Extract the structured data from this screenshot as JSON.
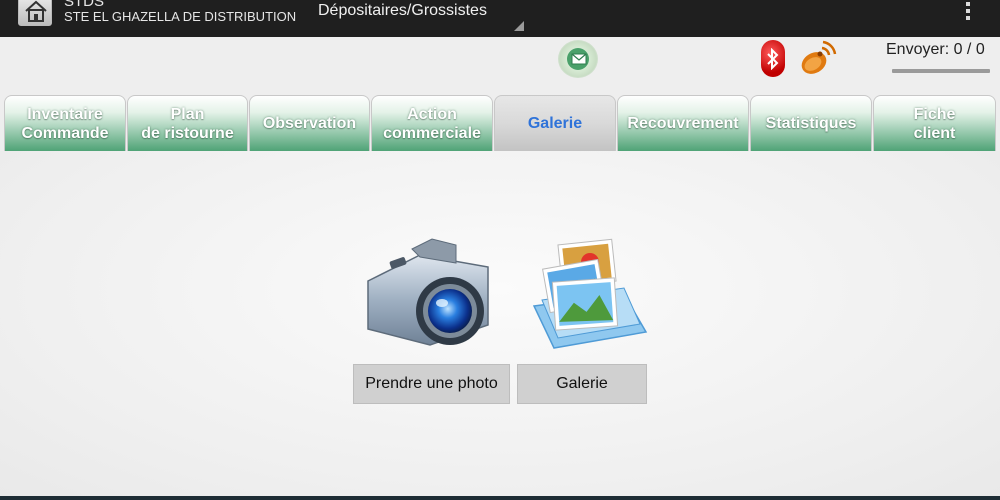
{
  "header": {
    "app_title": "STDS",
    "company": "STE EL GHAZELLA DE DISTRIBUTION",
    "spinner_value": "Dépositaires/Grossistes"
  },
  "status": {
    "envoyer_label": "Envoyer: 0 / 0"
  },
  "tabs": [
    {
      "line1": "Inventaire",
      "line2": "Commande"
    },
    {
      "line1": "Plan",
      "line2": "de ristourne"
    },
    {
      "line1": "Observation",
      "line2": ""
    },
    {
      "line1": "Action",
      "line2": "commerciale"
    },
    {
      "line1": "Galerie",
      "line2": ""
    },
    {
      "line1": "Recouvrement",
      "line2": ""
    },
    {
      "line1": "Statistiques",
      "line2": ""
    },
    {
      "line1": "Fiche",
      "line2": "client"
    }
  ],
  "active_tab": "Galerie",
  "main": {
    "take_photo_label": "Prendre une photo",
    "gallery_label": "Galerie"
  },
  "icons": {
    "home": "home-icon",
    "mail": "mail-icon",
    "bluetooth": "bluetooth-icon",
    "gps": "gps-satellite-icon",
    "camera": "camera-icon",
    "gallery": "gallery-icon",
    "overflow": "overflow-menu-icon"
  },
  "colors": {
    "actionbar": "#1f1f1f",
    "tab_green": "#4fa376",
    "active_tab_text": "#2f73d9",
    "button_bg": "#d0d0d0"
  }
}
